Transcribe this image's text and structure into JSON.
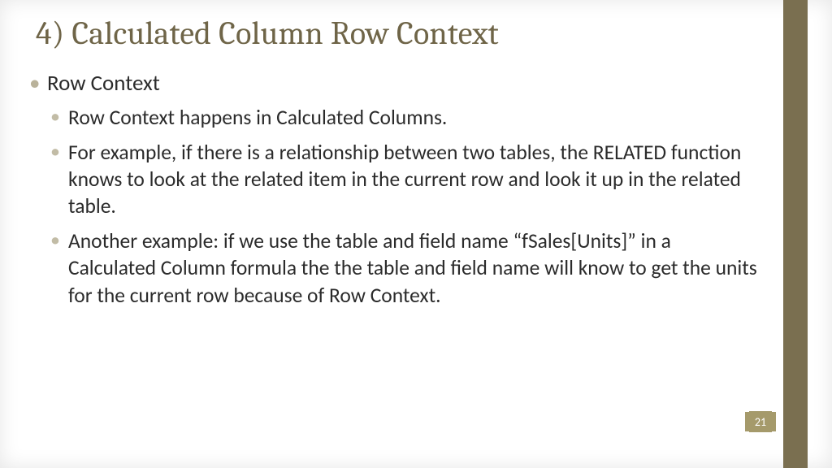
{
  "title": "4) Calculated Column Row Context",
  "bullets": {
    "top": "Row Context",
    "sub1": "Row Context happens in Calculated Columns.",
    "sub2": "For example, if there is a relationship between two tables, the RELATED function knows to look at the related item in the current row and look it up in the related table.",
    "sub3": "Another example: if we use the table and field name “fSales[Units]” in a Calculated Column formula the the table and field name will know to get the units for the current row because of Row Context."
  },
  "page_number": "21"
}
